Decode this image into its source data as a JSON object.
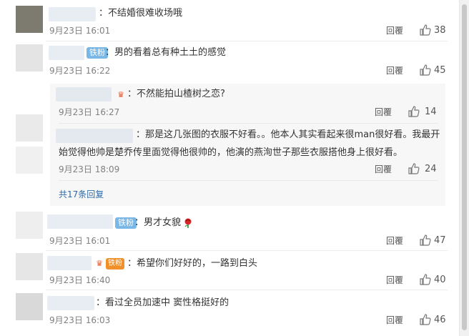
{
  "comments": [
    {
      "text": "：不结婚很难收场哦",
      "date": "9月23日 16:01",
      "reply": "回覆",
      "likes": "38"
    },
    {
      "badge": "铁粉",
      "text": "：男的看着总有种土土的感觉",
      "date": "9月23日 16:22",
      "reply": "回覆",
      "likes": "45"
    },
    {
      "text": "：男才女貌",
      "badge": "铁粉",
      "date": "9月23日 16:01",
      "reply": "回覆",
      "likes": "47"
    },
    {
      "text": "：希望你们好好的，一路到白头",
      "date": "9月23日 16:40",
      "reply": "回覆",
      "likes": "40"
    },
    {
      "text": "：看过全员加速中 窦性格挺好的",
      "date": "9月23日 16:03",
      "reply": "回覆",
      "likes": "46"
    }
  ],
  "sub_replies": [
    {
      "text": "：不然能拍山楂树之恋?",
      "date": "9月23日 16:27",
      "reply": "回覆",
      "likes": "14"
    },
    {
      "text_line1": "：那是这几张图的衣服不好看。。他本人其实看起来很man很好看。我最开",
      "text_line2": "始觉得他帅是楚乔传里面觉得他很帅的，他演的燕洵世子那些衣服搭他身上很好看。",
      "date": "9月23日 18:09",
      "reply": "回覆",
      "likes": "24"
    }
  ],
  "more_replies": "共17条回复",
  "icons": {
    "thumb": "thumbs-up-icon",
    "rose": "rose-emoji-icon"
  }
}
